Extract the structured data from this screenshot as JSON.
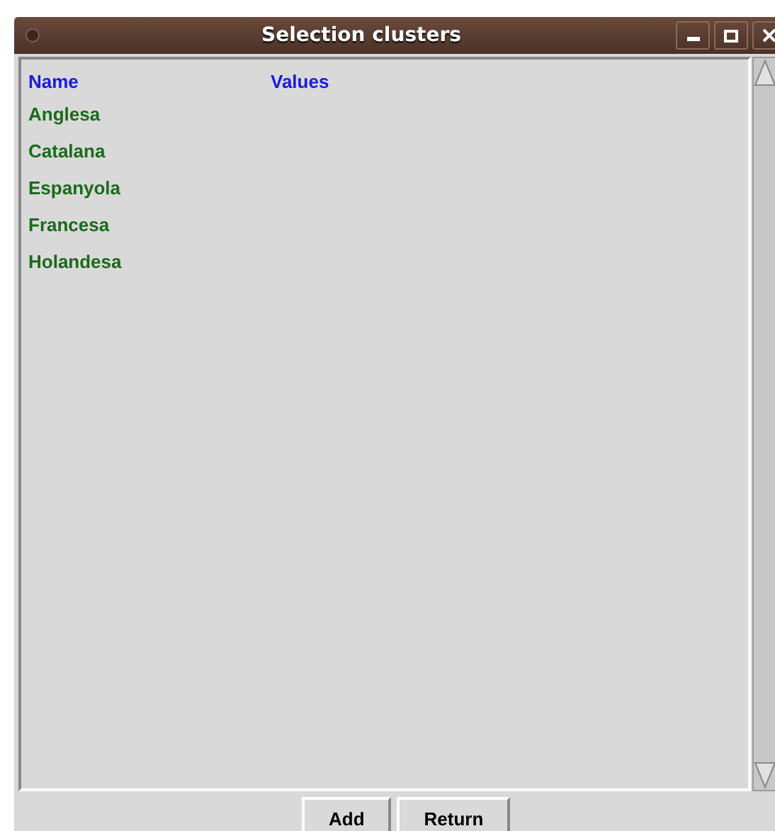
{
  "window": {
    "title": "Selection clusters"
  },
  "table": {
    "columns": [
      "Name",
      "Values"
    ],
    "rows": [
      {
        "name": "Anglesa"
      },
      {
        "name": "Catalana"
      },
      {
        "name": "Espanyola"
      },
      {
        "name": "Francesa"
      },
      {
        "name": "Holandesa"
      }
    ]
  },
  "buttons": [
    "Add",
    "Return"
  ]
}
